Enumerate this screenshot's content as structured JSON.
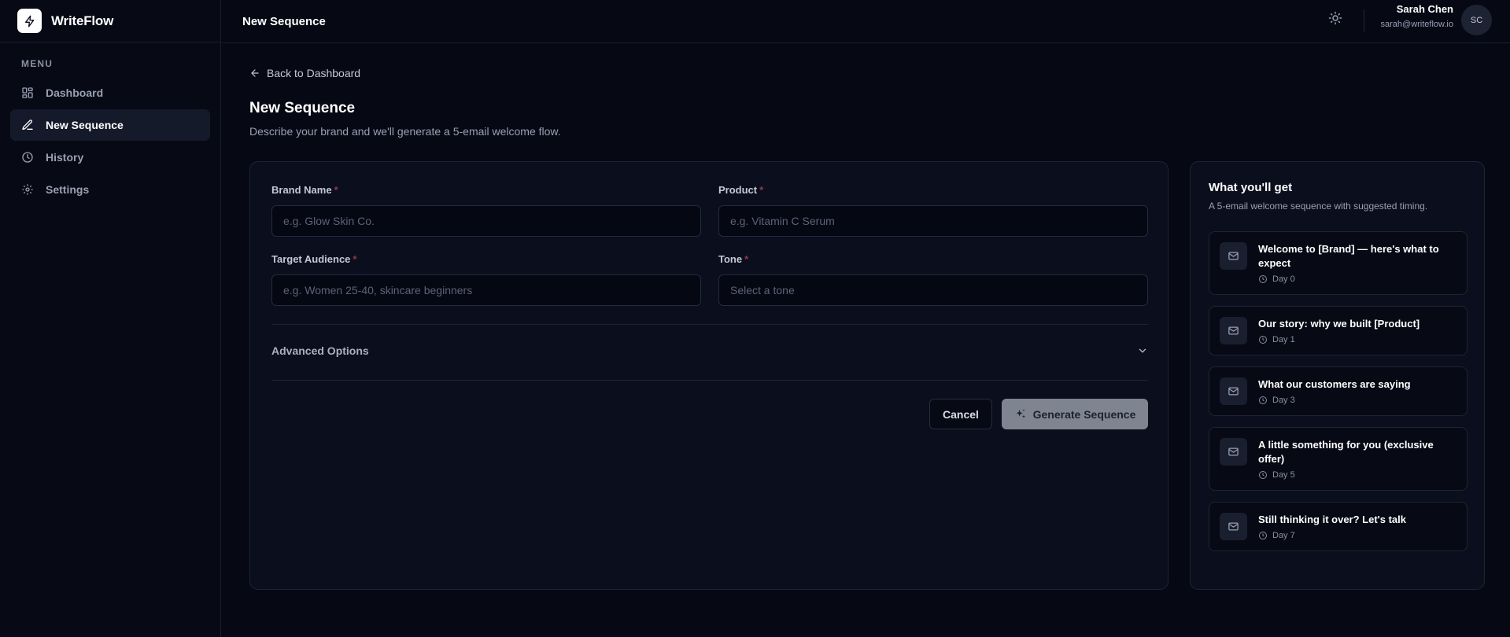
{
  "app": {
    "name": "WriteFlow"
  },
  "sidebar": {
    "menu_label": "MENU",
    "items": [
      {
        "label": "Dashboard",
        "icon": "grid-icon",
        "active": false
      },
      {
        "label": "New Sequence",
        "icon": "pen-icon",
        "active": true
      },
      {
        "label": "History",
        "icon": "clock-icon",
        "active": false
      },
      {
        "label": "Settings",
        "icon": "gear-icon",
        "active": false
      }
    ]
  },
  "header": {
    "title": "New Sequence",
    "user": {
      "name": "Sarah Chen",
      "email": "sarah@writeflow.io",
      "initials": "SC"
    }
  },
  "page": {
    "back_label": "Back to Dashboard",
    "title": "New Sequence",
    "subtitle": "Describe your brand and we'll generate a 5-email welcome flow."
  },
  "form": {
    "brand_name": {
      "label": "Brand Name",
      "required_mark": "*",
      "placeholder": "e.g. Glow Skin Co.",
      "value": ""
    },
    "product": {
      "label": "Product",
      "required_mark": "*",
      "placeholder": "e.g. Vitamin C Serum",
      "value": ""
    },
    "audience": {
      "label": "Target Audience",
      "required_mark": "*",
      "placeholder": "e.g. Women 25-40, skincare beginners",
      "value": ""
    },
    "tone": {
      "label": "Tone",
      "required_mark": "*",
      "placeholder": "Select a tone"
    },
    "advanced_label": "Advanced Options",
    "cancel_label": "Cancel",
    "generate_label": "Generate Sequence"
  },
  "preview": {
    "title": "What you'll get",
    "subtitle": "A 5-email welcome sequence with suggested timing.",
    "emails": [
      {
        "subject": "Welcome to [Brand] — here's what to expect",
        "day": "Day 0"
      },
      {
        "subject": "Our story: why we built [Product]",
        "day": "Day 1"
      },
      {
        "subject": "What our customers are saying",
        "day": "Day 3"
      },
      {
        "subject": "A little something for you (exclusive offer)",
        "day": "Day 5"
      },
      {
        "subject": "Still thinking it over? Let's talk",
        "day": "Day 7"
      }
    ]
  },
  "colors": {
    "background": "#060814",
    "card": "#0b0e1c",
    "border": "#1f2435",
    "active_nav": "#151a2b",
    "generate_button": "#7f8590"
  }
}
